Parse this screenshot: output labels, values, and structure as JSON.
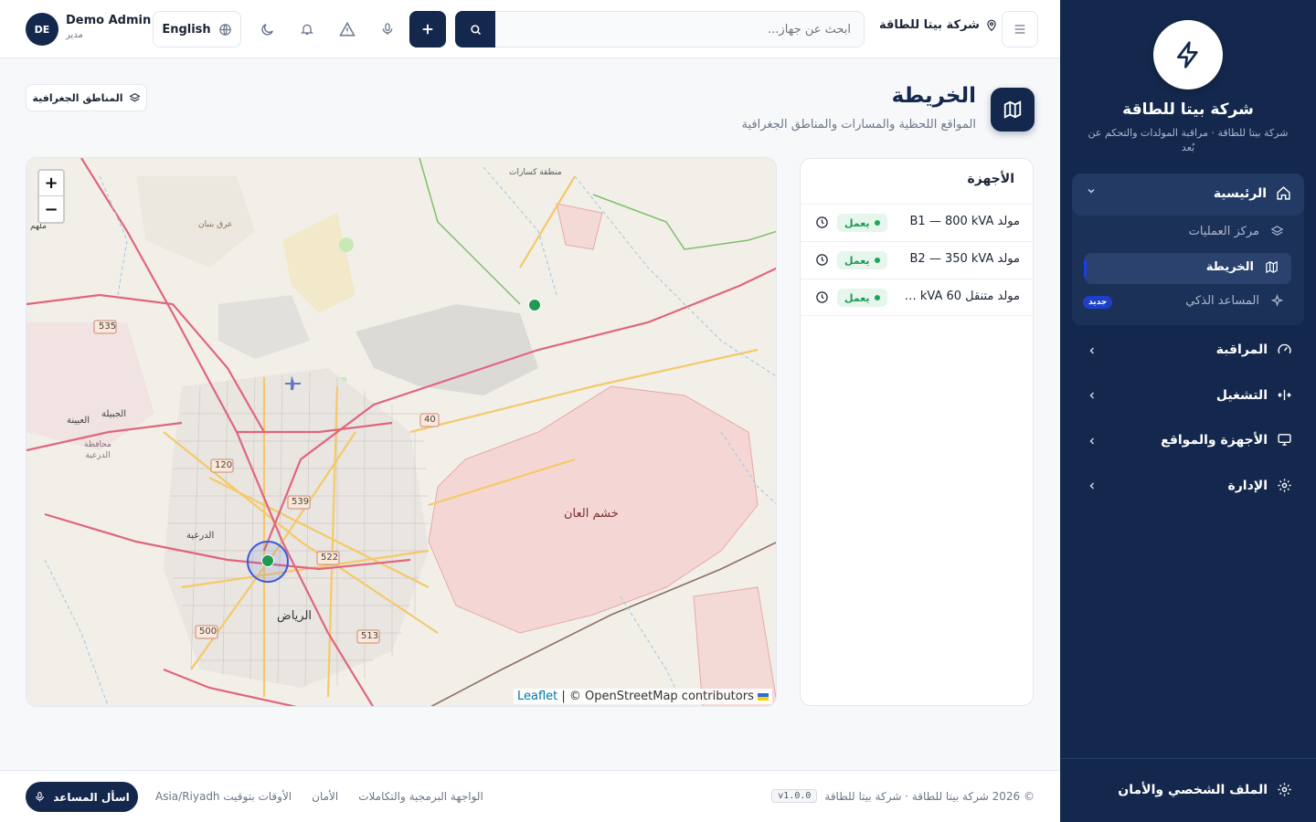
{
  "sidebar": {
    "brand_title": "شركة بيتا للطاقة",
    "brand_subtitle": "شركة بيتا للطاقة · مراقبة المولدات والتحكم عن بُعد",
    "nav": {
      "home": "الرئيسية",
      "operations_center": "مركز العمليات",
      "map": "الخريطة",
      "smart_assistant": "المساعد الذكي",
      "new_badge": "جديد",
      "monitoring": "المراقبة",
      "operation": "التشغيل",
      "devices_sites": "الأجهزة والمواقع",
      "administration": "الإدارة"
    },
    "footer_label": "الملف الشخصي والأمان"
  },
  "topbar": {
    "avatar_initials": "DE",
    "user_name": "Demo Admin",
    "user_role": "مدير",
    "language": "English",
    "search_placeholder": "ابحث عن جهاز...",
    "company": "شركة بيتا للطاقة"
  },
  "page": {
    "title": "الخريطة",
    "subtitle": "المواقع اللحظية والمسارات والمناطق الجغرافية",
    "geo_zones_button": "المناطق الجغرافية"
  },
  "map": {
    "zoom_in": "+",
    "zoom_out": "−",
    "attribution_link": "Leaflet",
    "attribution_text": " | © OpenStreetMap contributors",
    "labels": {
      "riyadh": "الرياض",
      "khashm": "خشم العان",
      "kasarat": "منطقة كسارات",
      "diriyah": "الدرعية",
      "jubaila": "الجبيلة",
      "uyaynah": "العيينة",
      "diriyah_gov": "محافظة الدرعية",
      "banban": "عرق بنبان",
      "malham": "ملهم",
      "r535": "535",
      "r120": "120",
      "r539": "539",
      "r522": "522",
      "r500": "500",
      "r513": "513",
      "r40": "40"
    },
    "colors": {
      "marker": "#1f9a52",
      "selection_ring": "#3b5bdb"
    }
  },
  "devices": {
    "title": "الأجهزة",
    "items": [
      {
        "name": "مولد B1 — 800 kVA",
        "status": "يعمل"
      },
      {
        "name": "مولد B2 — 350 kVA",
        "status": "يعمل"
      },
      {
        "name": "مولد متنقل 60 kVA …",
        "status": "يعمل"
      }
    ]
  },
  "footer": {
    "ask_assistant": "اسأل المساعد",
    "timezone_note": "الأوقات بتوقيت Asia/Riyadh",
    "security": "الأمان",
    "api": "الواجهة البرمجية والتكاملات",
    "copyright": "© 2026 شركة بيتا للطاقة · شركة بيتا للطاقة",
    "version": "v1.0.0"
  },
  "colors": {
    "navy": "#14284d",
    "status_green": "#1f9a52"
  }
}
